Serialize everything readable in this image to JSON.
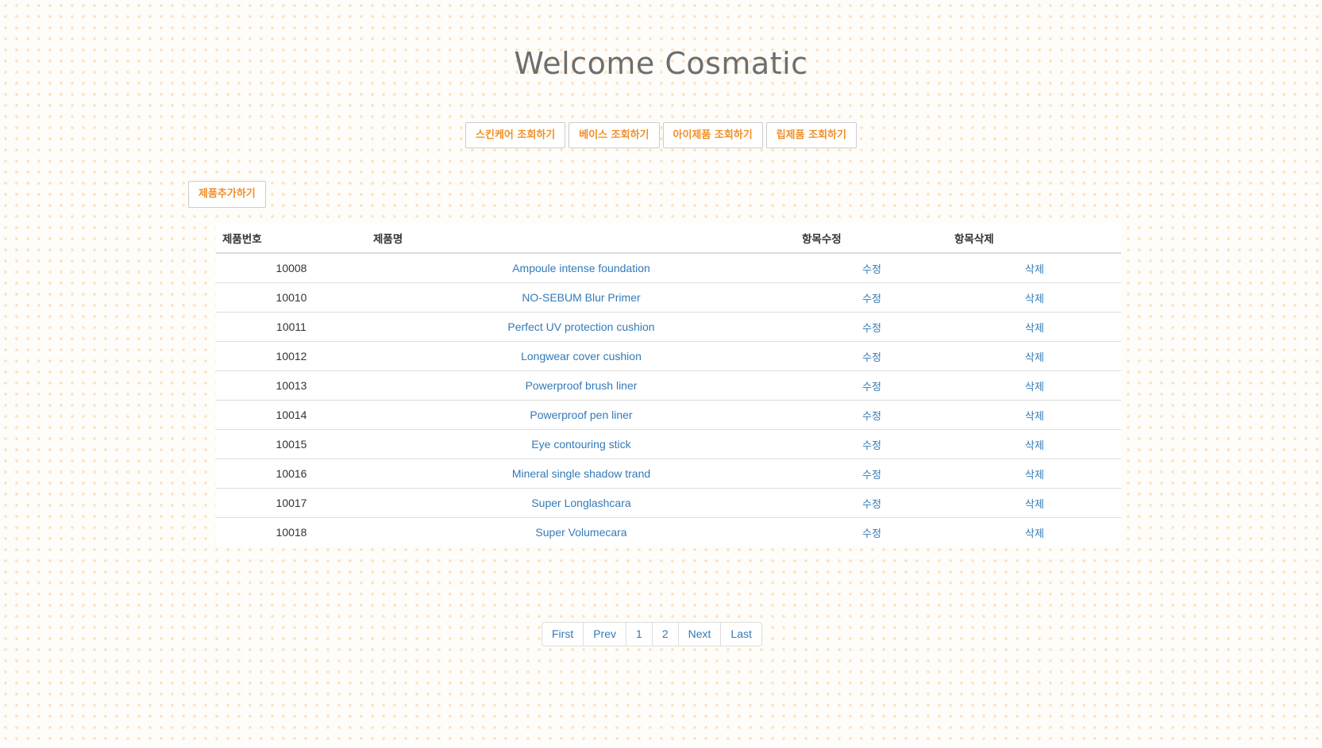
{
  "header": {
    "title": "Welcome Cosmatic"
  },
  "categories": [
    {
      "label": "스킨케어 조회하기"
    },
    {
      "label": "베이스 조회하기"
    },
    {
      "label": "아이제품 조회하기"
    },
    {
      "label": "립제품 조회하기"
    }
  ],
  "actions": {
    "add_product_label": "제품추가하기"
  },
  "table": {
    "columns": [
      "제품번호",
      "제품명",
      "항목수정",
      "항목삭제"
    ],
    "rows": [
      {
        "id": "10008",
        "name": "Ampoule intense foundation",
        "edit": "수정",
        "delete": "삭제"
      },
      {
        "id": "10010",
        "name": "NO-SEBUM Blur Primer",
        "edit": "수정",
        "delete": "삭제"
      },
      {
        "id": "10011",
        "name": "Perfect UV protection cushion",
        "edit": "수정",
        "delete": "삭제"
      },
      {
        "id": "10012",
        "name": "Longwear cover cushion",
        "edit": "수정",
        "delete": "삭제"
      },
      {
        "id": "10013",
        "name": "Powerproof brush liner",
        "edit": "수정",
        "delete": "삭제"
      },
      {
        "id": "10014",
        "name": "Powerproof pen liner",
        "edit": "수정",
        "delete": "삭제"
      },
      {
        "id": "10015",
        "name": "Eye contouring stick",
        "edit": "수정",
        "delete": "삭제"
      },
      {
        "id": "10016",
        "name": "Mineral single shadow trand",
        "edit": "수정",
        "delete": "삭제"
      },
      {
        "id": "10017",
        "name": "Super Longlashcara",
        "edit": "수정",
        "delete": "삭제"
      },
      {
        "id": "10018",
        "name": "Super Volumecara",
        "edit": "수정",
        "delete": "삭제"
      }
    ]
  },
  "pagination": {
    "items": [
      {
        "label": "First",
        "name": "pagination-first"
      },
      {
        "label": "Prev",
        "name": "pagination-prev"
      },
      {
        "label": "1",
        "name": "pagination-page-1"
      },
      {
        "label": "2",
        "name": "pagination-page-2"
      },
      {
        "label": "Next",
        "name": "pagination-next"
      },
      {
        "label": "Last",
        "name": "pagination-last"
      }
    ]
  },
  "colors": {
    "accent": "#f0902a",
    "link": "#337ab7",
    "title": "#6e6e6e",
    "background_dots": "#fde3c2"
  }
}
